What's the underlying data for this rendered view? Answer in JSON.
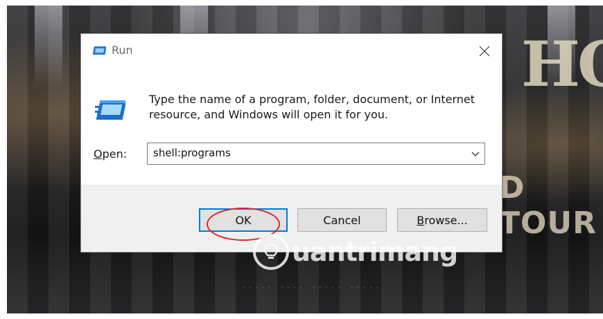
{
  "dialog": {
    "title": "Run",
    "description": "Type the name of a program, folder, document, or Internet resource, and Windows will open it for you.",
    "open_label_mnemonic": "O",
    "open_label_rest": "pen:",
    "open_value": "shell:programs"
  },
  "buttons": {
    "ok_label": "OK",
    "cancel_label": "Cancel",
    "browse_mnemonic": "B",
    "browse_rest": "rowse..."
  },
  "background": {
    "poster_letters": "HO",
    "poster_subtext": "D TOUR"
  },
  "watermark": {
    "text": "uantrimang"
  },
  "colors": {
    "accent": "#0078d7",
    "highlight": "#d8262a",
    "footer": "#f0f0f0"
  },
  "icons": {
    "title": "run-icon",
    "big": "run-large-icon",
    "close": "close-icon",
    "dropdown": "chevron-down-icon",
    "watermark": "lightbulb-icon"
  }
}
